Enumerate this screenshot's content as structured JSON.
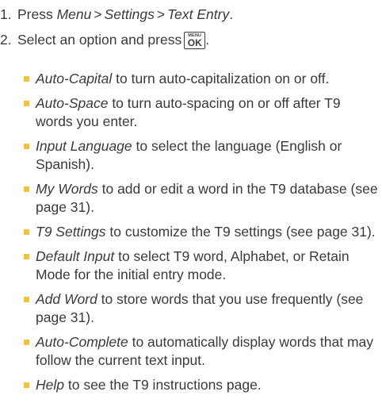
{
  "steps": [
    {
      "number": "1.",
      "prefix": "Press ",
      "path": [
        "Menu",
        "Settings",
        "Text Entry"
      ],
      "separator": ">",
      "suffix": "."
    },
    {
      "number": "2.",
      "text": "Select an option and press",
      "key": {
        "top": "MENU",
        "bottom": "OK"
      },
      "suffix": "."
    }
  ],
  "options": [
    {
      "term": "Auto-Capital",
      "desc": " to turn auto-capitalization on or off."
    },
    {
      "term": "Auto-Space",
      "desc": " to turn auto-spacing on or off after T9 words you enter."
    },
    {
      "term": "Input Language",
      "desc": " to select the language (English or Spanish)."
    },
    {
      "term": "My Words",
      "desc": " to add or edit a word in the T9 database (see page 31)."
    },
    {
      "term": "T9 Settings",
      "desc": " to customize the T9 settings (see page 31)."
    },
    {
      "term": "Default Input",
      "desc": " to select T9 word, Alphabet, or Retain Mode for the initial entry mode."
    },
    {
      "term": "Add Word",
      "desc": " to store words that you use frequently (see page 31)."
    },
    {
      "term": "Auto-Complete",
      "desc": " to automatically display words that may follow the current text input."
    },
    {
      "term": "Help",
      "desc": " to see the T9 instructions page."
    }
  ],
  "colors": {
    "text": "#3a3a3a",
    "bullet": "#f2c23a"
  }
}
